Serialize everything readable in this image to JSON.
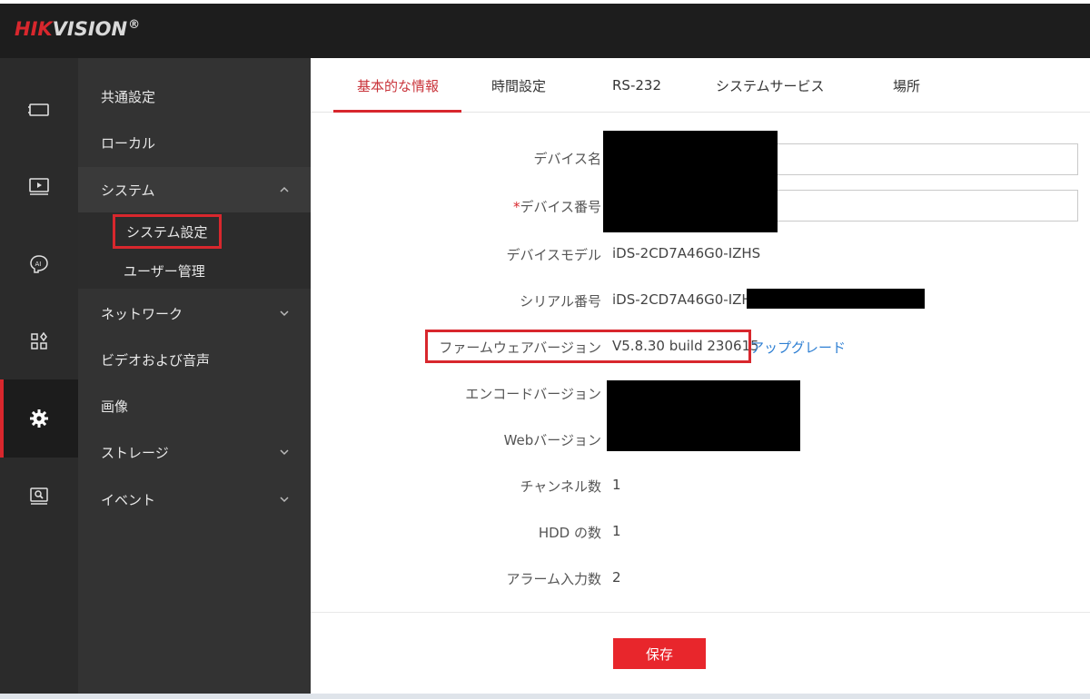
{
  "brand": {
    "logo_red": "HIK",
    "logo_gray": "VISION",
    "logo_reg": "®"
  },
  "rail": [
    {
      "icon": "monitor-icon",
      "active": false
    },
    {
      "icon": "playback-icon",
      "active": false
    },
    {
      "icon": "ai-icon",
      "active": false
    },
    {
      "icon": "apps-icon",
      "active": false
    },
    {
      "icon": "gear-icon",
      "active": true
    },
    {
      "icon": "maintenance-icon",
      "active": false
    }
  ],
  "menu": {
    "items": [
      {
        "label": "共通設定"
      },
      {
        "label": "ローカル"
      },
      {
        "label": "システム",
        "expanded": true
      },
      {
        "label": "ネットワーク"
      },
      {
        "label": "ビデオおよび音声"
      },
      {
        "label": "画像"
      },
      {
        "label": "ストレージ"
      },
      {
        "label": "イベント"
      }
    ],
    "submenu": [
      {
        "label": "システム設定",
        "selected": true
      },
      {
        "label": "ユーザー管理"
      }
    ]
  },
  "tabs": [
    {
      "label": "基本的な情報",
      "active": true
    },
    {
      "label": "時間設定"
    },
    {
      "label": "RS-232"
    },
    {
      "label": "システムサービス"
    },
    {
      "label": "場所"
    }
  ],
  "form": {
    "device_name_label": "デバイス名",
    "device_no_required": "*",
    "device_no_label": "デバイス番号",
    "model_label": "デバイスモデル",
    "model_value": "iDS-2CD7A46G0-IZHS",
    "serial_label": "シリアル番号",
    "serial_value": "iDS-2CD7A46G0-IZHS",
    "firmware_label": "ファームウェアバージョン",
    "firmware_value": "V5.8.30 build 230615",
    "upgrade_link": "アップグレード",
    "encode_label": "エンコードバージョン",
    "web_label": "Webバージョン",
    "channels_label": "チャンネル数",
    "channels_value": "1",
    "hdd_label": "HDD の数",
    "hdd_value": "1",
    "alarm_label": "アラーム入力数",
    "alarm_value": "2"
  },
  "actions": {
    "save": "保存"
  },
  "colors": {
    "accent": "#d8272d",
    "link": "#2e7fd3",
    "sidebar": "#333333",
    "rail": "#2b2b2b",
    "topbar": "#1d1d1d"
  }
}
